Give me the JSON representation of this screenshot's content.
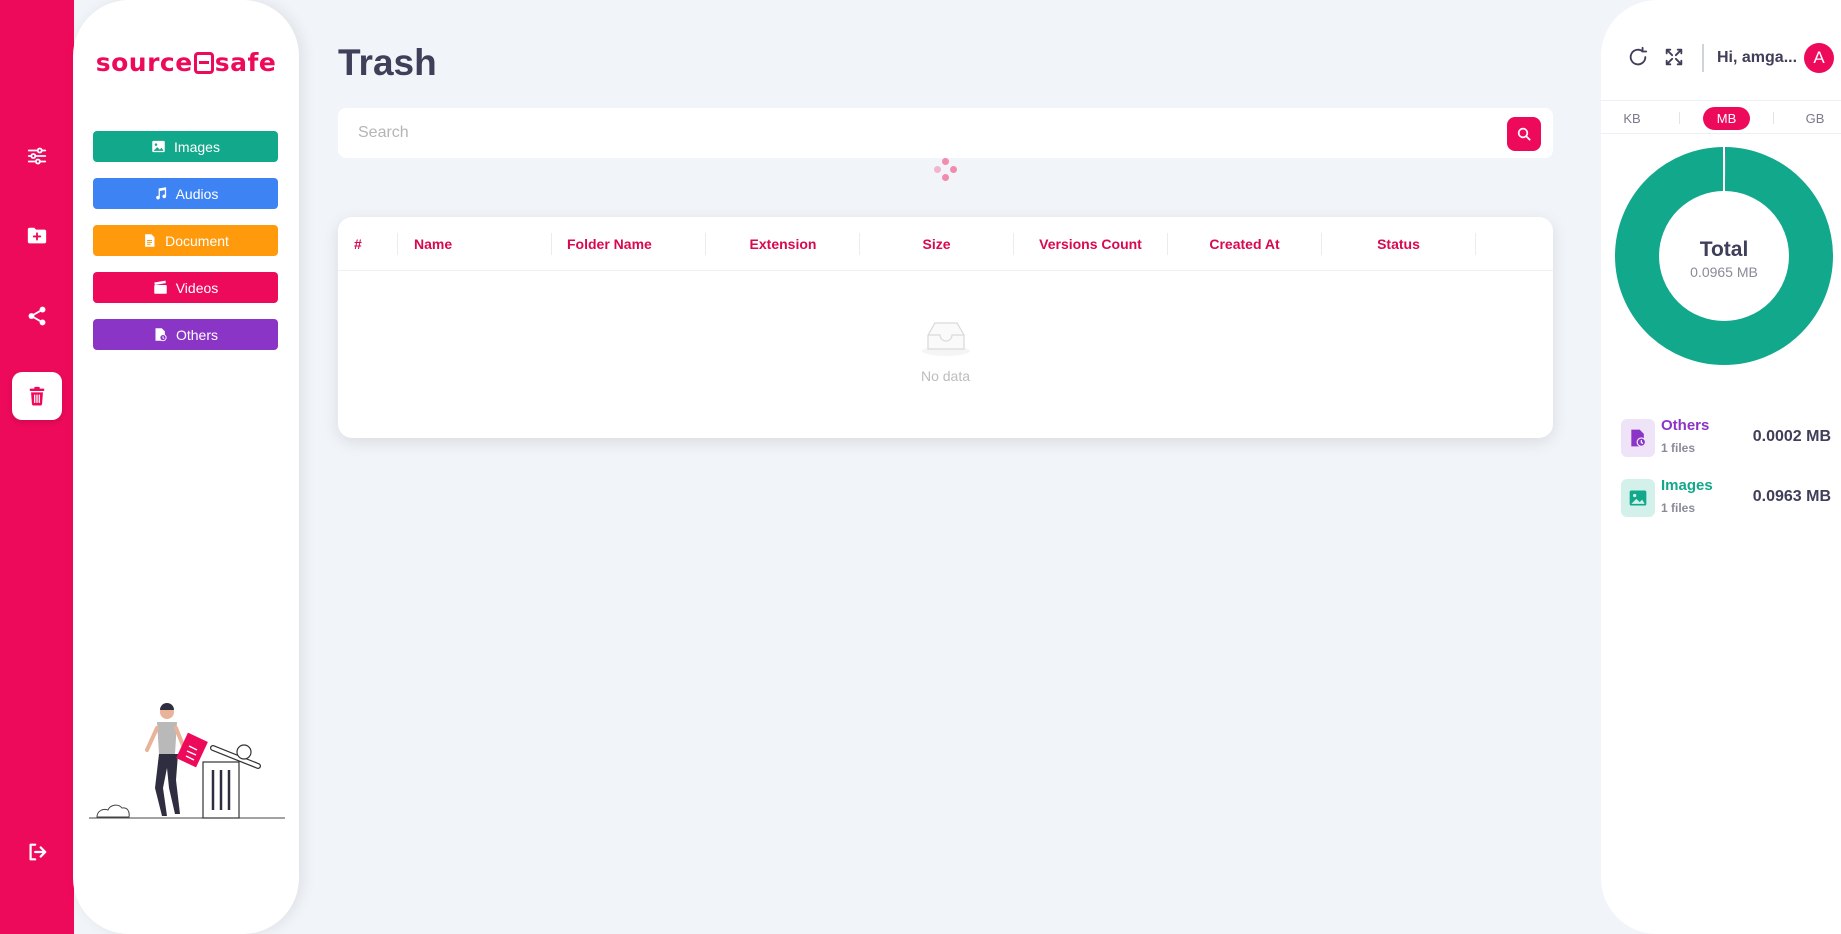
{
  "app": {
    "logo_left": "source",
    "logo_right": "safe",
    "accent": "#ee0a5b"
  },
  "rail": {
    "items": [
      {
        "icon": "sliders-icon",
        "label": "filters"
      },
      {
        "icon": "folder-plus-icon",
        "label": "new folder"
      },
      {
        "icon": "share-icon",
        "label": "shared"
      },
      {
        "icon": "trash-icon",
        "label": "trash",
        "active": true
      },
      {
        "icon": "logout-icon",
        "label": "logout"
      }
    ]
  },
  "categories": [
    {
      "label": "Images",
      "color": "#12a88b",
      "icon": "image-icon"
    },
    {
      "label": "Audios",
      "color": "#3d83f3",
      "icon": "music-icon"
    },
    {
      "label": "Document",
      "color": "#ff9a0d",
      "icon": "document-icon"
    },
    {
      "label": "Videos",
      "color": "#ee0a5b",
      "icon": "video-icon"
    },
    {
      "label": "Others",
      "color": "#8b35c7",
      "icon": "other-file-icon"
    }
  ],
  "main": {
    "title": "Trash",
    "search_placeholder": "Search",
    "columns": [
      "#",
      "Name",
      "Folder Name",
      "Extension",
      "Size",
      "Versions Count",
      "Created At",
      "Status"
    ],
    "rows": [],
    "empty_text": "No data"
  },
  "header": {
    "greeting": "Hi, amga...",
    "avatar_letter": "A"
  },
  "units": {
    "options": [
      "KB",
      "MB",
      "GB"
    ],
    "selected": "MB"
  },
  "storage": {
    "total_label": "Total",
    "total_value": "0.0965 MB",
    "items": [
      {
        "name": "Others",
        "files": "1 files",
        "size": "0.0002 MB",
        "color": "#8b35c7",
        "bg": "#efe3f8",
        "icon": "other-file-icon"
      },
      {
        "name": "Images",
        "files": "1 files",
        "size": "0.0963 MB",
        "color": "#12a88b",
        "bg": "#d3f1ea",
        "icon": "image-icon"
      }
    ]
  },
  "chart_data": {
    "type": "pie",
    "categories": [
      "Others",
      "Images"
    ],
    "values": [
      0.0002,
      0.0963
    ],
    "colors": [
      "#8b35c7",
      "#12a88b"
    ],
    "title": "Total",
    "center_value": "0.0965 MB"
  }
}
